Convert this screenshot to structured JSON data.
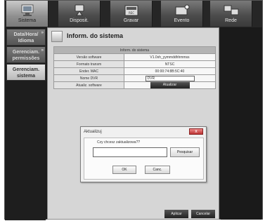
{
  "tabs": [
    {
      "label": "Sistema",
      "icon": "system-icon",
      "active": true
    },
    {
      "label": "Disposit.",
      "icon": "device-icon",
      "active": false
    },
    {
      "label": "Gravar",
      "icon": "record-icon",
      "active": false
    },
    {
      "label": "Evento",
      "icon": "event-icon",
      "active": false
    },
    {
      "label": "Rede",
      "icon": "network-icon",
      "active": false
    }
  ],
  "sidebar": {
    "items": [
      {
        "label": "Data/Hora/\nIdioma",
        "active": false
      },
      {
        "label": "Gerenciam.\npermissões",
        "active": false
      },
      {
        "label": "Gerenciam.\nsistema",
        "active": true
      }
    ]
  },
  "main": {
    "title": "Inform. do sistema",
    "table_header": "Inform. do sistema",
    "rows": [
      {
        "key": "Versão software",
        "value": "V1.0xh_yymmddhhmmss"
      },
      {
        "key": "Formato transm",
        "value": "NTSC"
      },
      {
        "key": "Ender. MAC",
        "value": "00:00:74:8B:5C:40"
      },
      {
        "key": "Nome DVR",
        "value": "DVR"
      },
      {
        "key": "Atualiz. software",
        "value": "Atualizar"
      }
    ]
  },
  "dialog": {
    "title": "Aktualizuj",
    "question": "Czy chcesz zaktualizowa??",
    "field_value": "",
    "browse_label": "Pesquisar",
    "ok_label": "OK",
    "cancel_label": "Canc.",
    "close_label": "x"
  },
  "footer": {
    "apply_label": "Aplicar",
    "cancel_label": "Cancelar"
  },
  "colors": {
    "background": "#1c1c1c",
    "panel": "#d6d6d6",
    "active_tab": "#c9c9c9",
    "close_button": "#b33333"
  }
}
